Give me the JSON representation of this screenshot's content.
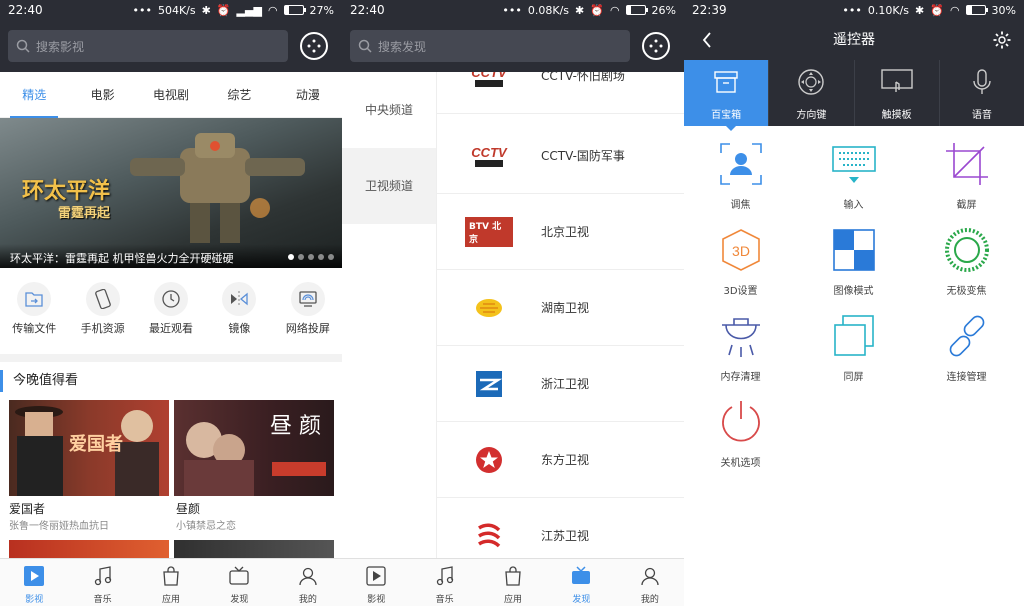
{
  "screens": [
    {
      "status": {
        "time": "22:40",
        "speed": "504K/s",
        "battery": "27%",
        "battery_level": 27
      },
      "search_placeholder": "搜索影视",
      "tabs": [
        "精选",
        "电影",
        "电视剧",
        "综艺",
        "动漫"
      ],
      "banner": {
        "title_main": "环太平洋",
        "title_sub": "雷霆再起",
        "caption": "环太平洋：雷霆再起 机甲怪兽火力全开硬碰硬"
      },
      "shortcuts": [
        "传输文件",
        "手机资源",
        "最近观看",
        "镜像",
        "网络投屏"
      ],
      "section_title": "今晚值得看",
      "videos": [
        {
          "title": "爱国者",
          "subtitle": "张鲁一佟丽娅热血抗日",
          "poster_text": "爱国者"
        },
        {
          "title": "昼颜",
          "subtitle": "小镇禁忌之恋",
          "poster_text": "昼 颜"
        }
      ],
      "nav": [
        "影视",
        "音乐",
        "应用",
        "发现",
        "我的"
      ],
      "nav_active": 0
    },
    {
      "status": {
        "time": "22:40",
        "speed": "0.08K/s",
        "battery": "26%",
        "battery_level": 26
      },
      "search_placeholder": "搜索发现",
      "categories": [
        "中央频道",
        "卫视频道"
      ],
      "channels": [
        {
          "name": "CCTV-怀旧剧场",
          "logo": "cctv-icon"
        },
        {
          "name": "CCTV-国防军事",
          "logo": "cctv-icon"
        },
        {
          "name": "北京卫视",
          "logo": "btv-icon",
          "logo_text": "BTV 北京"
        },
        {
          "name": "湖南卫视",
          "logo": "hunan-tv-icon"
        },
        {
          "name": "浙江卫视",
          "logo": "zhejiang-tv-icon"
        },
        {
          "name": "东方卫视",
          "logo": "dragon-tv-icon"
        },
        {
          "name": "江苏卫视",
          "logo": "jiangsu-tv-icon"
        }
      ],
      "nav": [
        "影视",
        "音乐",
        "应用",
        "发现",
        "我的"
      ],
      "nav_active": 3
    },
    {
      "status": {
        "time": "22:39",
        "speed": "0.10K/s",
        "battery": "30%",
        "battery_level": 30
      },
      "title": "遥控器",
      "modes": [
        "百宝箱",
        "方向键",
        "触摸板",
        "语音"
      ],
      "tools": [
        "调焦",
        "输入",
        "截屏",
        "3D设置",
        "图像模式",
        "无极变焦",
        "内存清理",
        "同屏",
        "连接管理",
        "关机选项"
      ]
    }
  ],
  "colors": {
    "accent": "#3d8fe8",
    "topbar": "#2b2d35"
  }
}
